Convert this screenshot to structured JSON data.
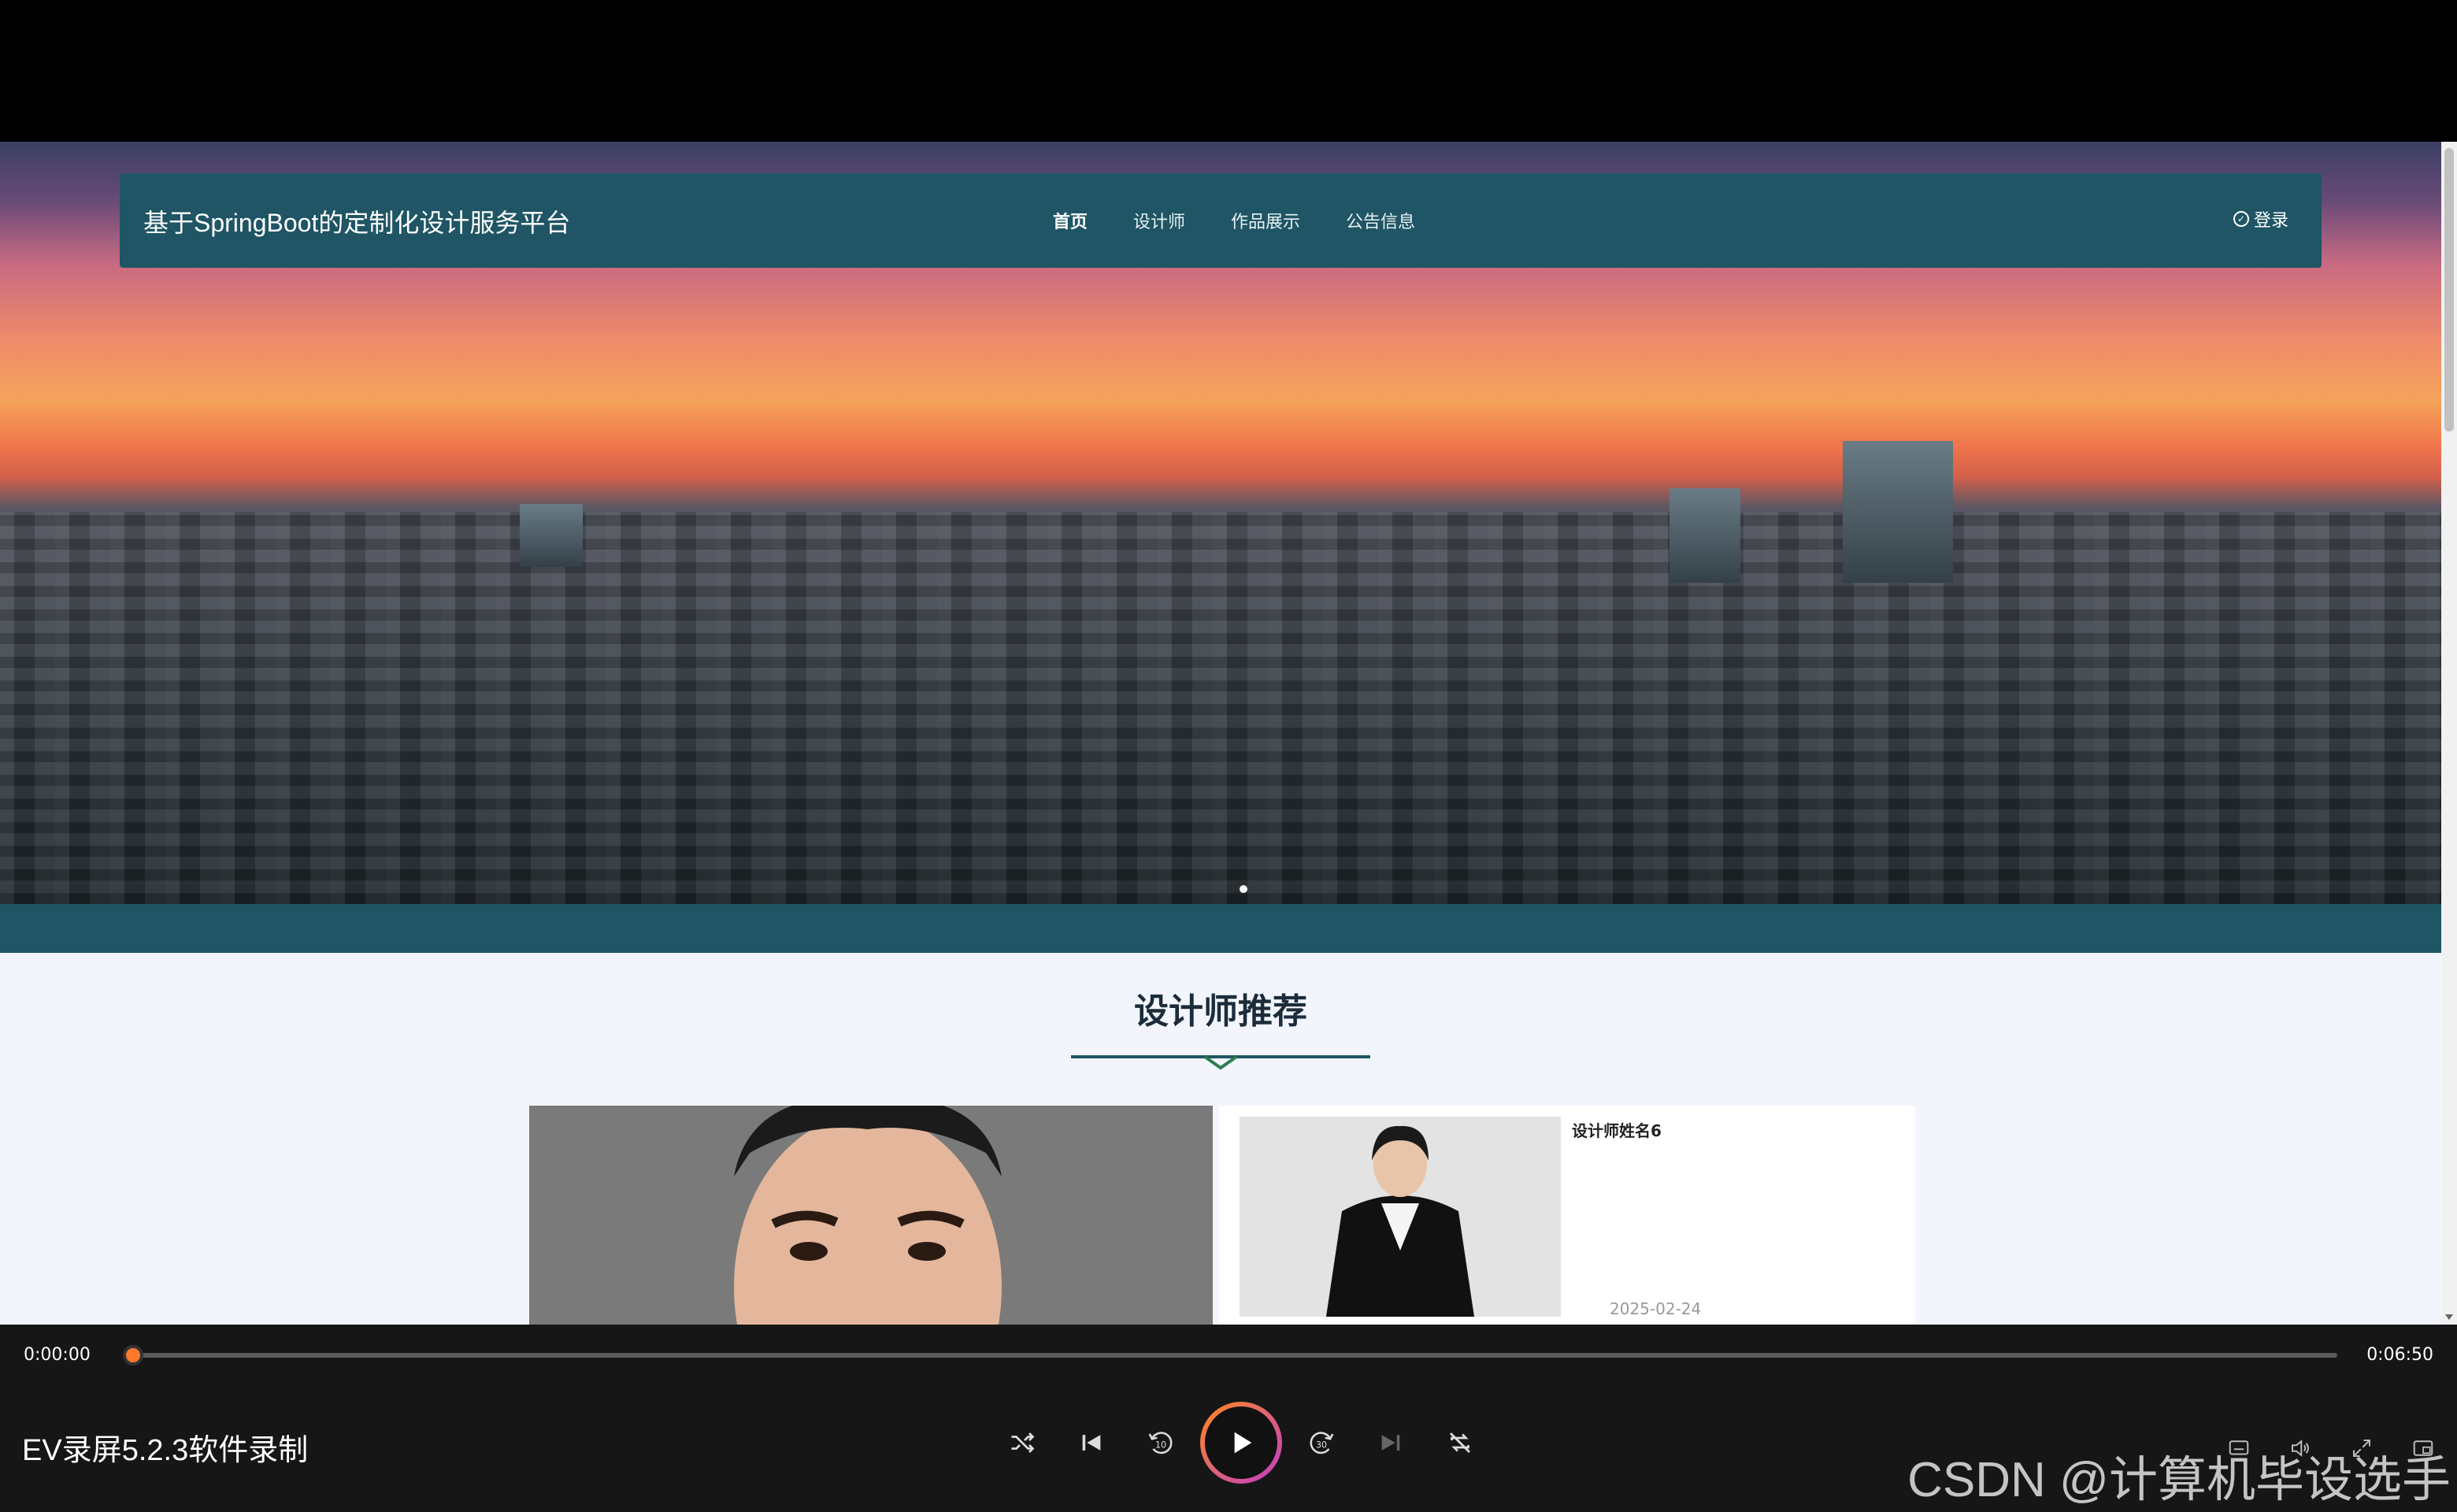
{
  "site": {
    "title": "基于SpringBoot的定制化设计服务平台",
    "nav": [
      "首页",
      "设计师",
      "作品展示",
      "公告信息"
    ],
    "active_nav": "首页",
    "login_label": "登录",
    "brand_color": "#1f5564"
  },
  "section": {
    "title": "设计师推荐"
  },
  "designers": [
    {
      "name": "设计师姓名6",
      "date": "2025-02-24"
    }
  ],
  "player": {
    "time_start": "0:00:00",
    "time_end": "0:06:50",
    "progress_fraction": 0.0,
    "recorder_label": "EV录屏5.2.3软件录制",
    "accent": "#ff7a2a",
    "controls": [
      "shuffle-icon",
      "skip-previous-icon",
      "rewind-10-icon",
      "play-icon",
      "forward-30-icon",
      "skip-next-icon",
      "repeat-off-icon"
    ],
    "right_controls": [
      "subtitle-icon",
      "volume-icon",
      "expand-icon",
      "mini-player-icon"
    ]
  },
  "watermark": "CSDN @计算机毕设选手"
}
